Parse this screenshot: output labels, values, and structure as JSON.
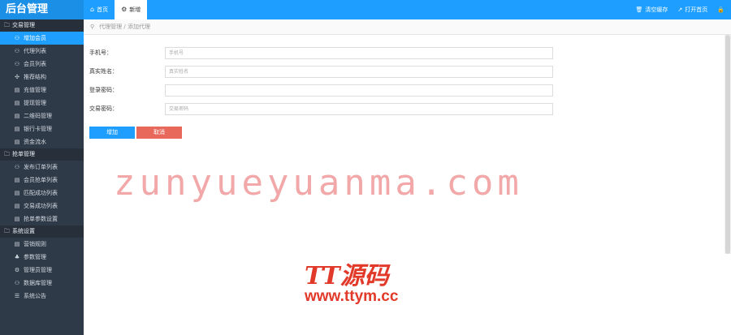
{
  "app": {
    "title": "后台管理"
  },
  "tabs": [
    {
      "label": "首页",
      "icon": "home-icon",
      "glyph": "⌂"
    },
    {
      "label": "新增",
      "icon": "gear-icon",
      "glyph": "⚙"
    }
  ],
  "topright": [
    {
      "label": "清空缓存",
      "icon": "trash-icon",
      "glyph": "🗑"
    },
    {
      "label": "打开首页",
      "icon": "external-link-icon",
      "glyph": "↗"
    },
    {
      "label": "",
      "icon": "lock-icon",
      "glyph": "🔒"
    }
  ],
  "sidebar": {
    "groups": [
      {
        "label": "交易管理",
        "items": [
          {
            "label": "增加会员",
            "glyph": "⚇"
          },
          {
            "label": "代理列表",
            "glyph": "⚇"
          },
          {
            "label": "会员列表",
            "glyph": "⚇"
          },
          {
            "label": "推荐结构",
            "glyph": "✣"
          },
          {
            "label": "充值管理",
            "glyph": "▤"
          },
          {
            "label": "提现管理",
            "glyph": "▤"
          },
          {
            "label": "二维码管理",
            "glyph": "▤"
          },
          {
            "label": "银行卡管理",
            "glyph": "▤"
          },
          {
            "label": "资金流水",
            "glyph": "▤"
          }
        ]
      },
      {
        "label": "抢单管理",
        "items": [
          {
            "label": "发布订单列表",
            "glyph": "⚇"
          },
          {
            "label": "会员抢单列表",
            "glyph": "▤"
          },
          {
            "label": "匹配成功列表",
            "glyph": "▤"
          },
          {
            "label": "交易成功列表",
            "glyph": "▤"
          },
          {
            "label": "抢单参数设置",
            "glyph": "▤"
          }
        ]
      },
      {
        "label": "系统设置",
        "items": [
          {
            "label": "营销规则",
            "glyph": "▤"
          },
          {
            "label": "参数管理",
            "glyph": "♣"
          },
          {
            "label": "管理员管理",
            "glyph": "⚙"
          },
          {
            "label": "数据库管理",
            "glyph": "⚇"
          },
          {
            "label": "系统公告",
            "glyph": "☰"
          }
        ]
      }
    ]
  },
  "breadcrumb": {
    "text": "代理管理 / 添加代理"
  },
  "form": {
    "fields": [
      {
        "label": "手机号：",
        "placeholder": "手机号"
      },
      {
        "label": "真实姓名：",
        "placeholder": "真实姓名"
      },
      {
        "label": "登录密码：",
        "placeholder": ""
      },
      {
        "label": "交易密码：",
        "placeholder": "交易密码"
      }
    ],
    "submit_label": "增加",
    "cancel_label": "取消"
  },
  "watermark": {
    "url_text": "zunyueyuanma.com",
    "brand_text": "TT源码",
    "site_text": "www.ttym.cc"
  }
}
